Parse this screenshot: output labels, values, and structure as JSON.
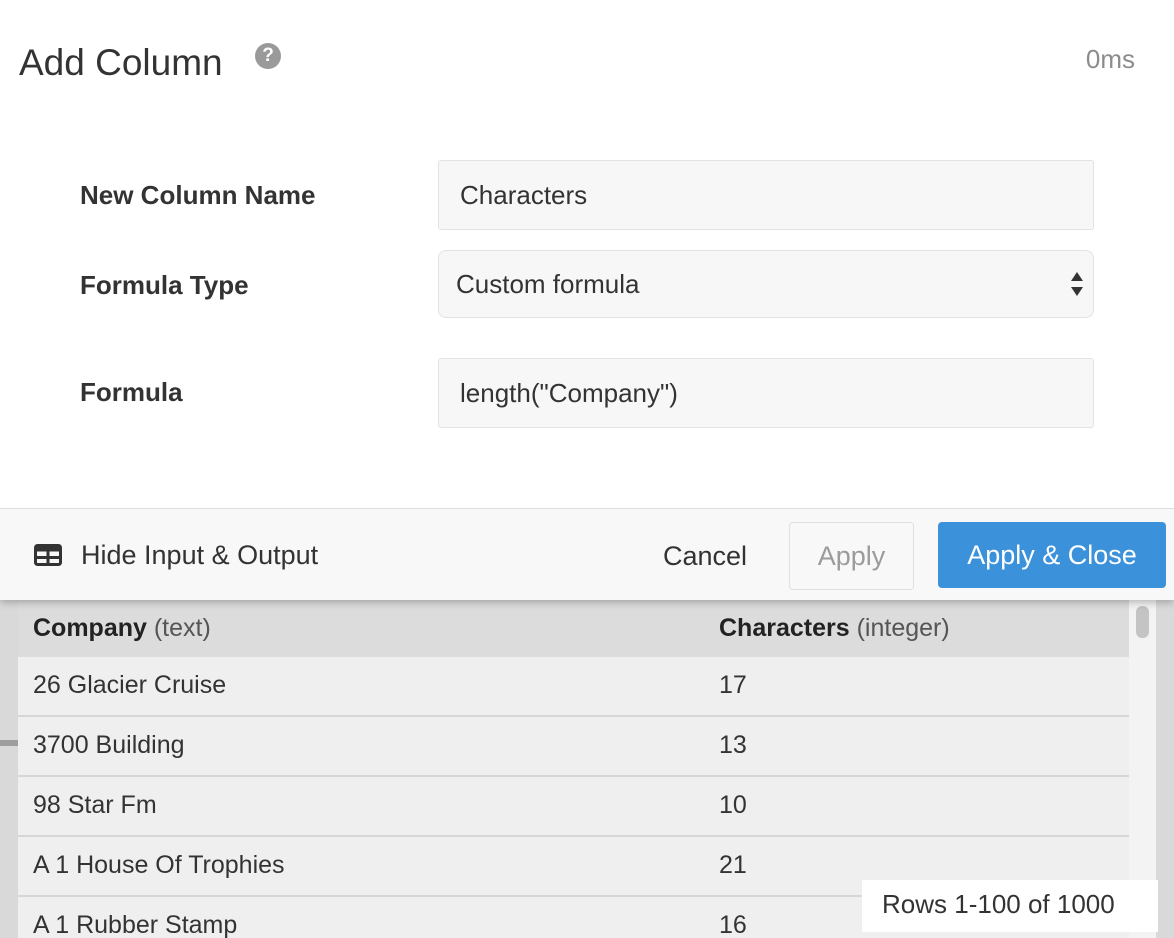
{
  "dialog": {
    "title": "Add Column",
    "help_icon": "question-circle-icon",
    "timing": "0ms"
  },
  "form": {
    "name_label": "New Column Name",
    "name_value": "Characters",
    "type_label": "Formula Type",
    "type_value": "Custom formula",
    "formula_label": "Formula",
    "formula_value": "length(\"Company\")"
  },
  "footer": {
    "toggle_icon": "table-icon",
    "toggle_label": "Hide Input & Output",
    "cancel_label": "Cancel",
    "apply_label": "Apply",
    "apply_close_label": "Apply & Close"
  },
  "preview": {
    "columns": [
      {
        "name": "Company",
        "type": "(text)"
      },
      {
        "name": "Characters",
        "type": "(integer)"
      }
    ],
    "rows": [
      [
        "26 Glacier Cruise",
        "17"
      ],
      [
        "3700 Building",
        "13"
      ],
      [
        "98 Star Fm",
        "10"
      ],
      [
        "A 1 House Of Trophies",
        "21"
      ],
      [
        "A 1 Rubber Stamp",
        "16"
      ]
    ],
    "row_count": "Rows 1-100 of 1000"
  },
  "colors": {
    "primary_button": "#3b92db",
    "header_background": "#dcdcdc",
    "row_background": "#efefef"
  }
}
